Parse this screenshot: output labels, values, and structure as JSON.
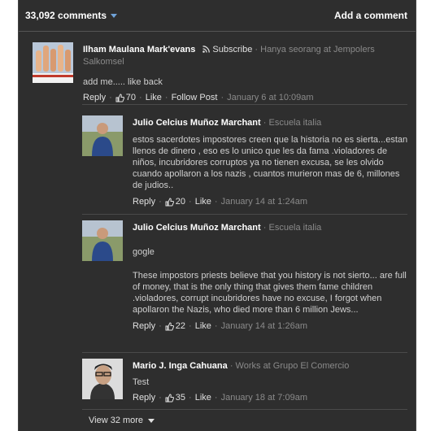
{
  "header": {
    "count": "33,092 comments",
    "add_comment": "Add a comment"
  },
  "comments": [
    {
      "name": "Ilham Maulana Mark'evans",
      "subscribe": "Subscribe",
      "info": "Hanya seorang at Jempolers Salkomsel",
      "text": "add me..... like back",
      "reply": "Reply",
      "likes": "70",
      "like": "Like",
      "follow": "Follow Post",
      "time": "January 6 at 10:09am",
      "avatar_caption": "Jempol"
    },
    {
      "name": "Julio Celcius Muñoz Marchant",
      "info": "Escuela italia",
      "text": "estos sacerdotes impostores creen que la historia no es sierta...estan llenos de dinero , eso es lo unico que les da fama .violadores de niños, incubridores corruptos ya no tienen excusa, se les olvido cuando apollaron a los nazis , cuantos murieron mas de 6, millones de judios..",
      "reply": "Reply",
      "likes": "20",
      "like": "Like",
      "time": "January 14 at 1:24am"
    },
    {
      "name": "Julio Celcius Muñoz Marchant",
      "info": "Escuela italia",
      "text1": "gogle",
      "text2": "These impostors priests believe that you history is not sierto... are full of money, that is the only thing that gives them fame children .violadores, corrupt incubridores have no excuse, I forgot when apollaron the Nazis, who died more than 6 million Jews...",
      "reply": "Reply",
      "likes": "22",
      "like": "Like",
      "time": "January 14 at 1:26am"
    },
    {
      "name": "Mario J. Inga Cahuana",
      "info": "Works at Grupo El Comercio",
      "text": "Test",
      "reply": "Reply",
      "likes": "35",
      "like": "Like",
      "time": "January 18 at 7:09am"
    }
  ],
  "view_more": "View 32 more",
  "colors": {
    "panel": "#2e2e2e",
    "link_blue": "#6fa2d8",
    "muted": "#8a8a8a"
  }
}
